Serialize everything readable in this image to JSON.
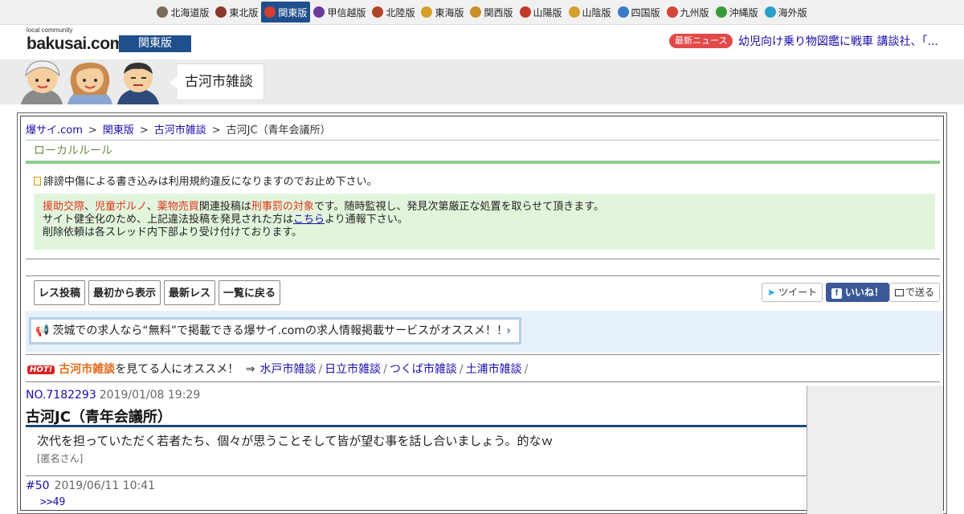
{
  "regions": [
    {
      "label": "北海道版",
      "color": "#7a6a5a",
      "active": false
    },
    {
      "label": "東北版",
      "color": "#8a3a2a",
      "active": false
    },
    {
      "label": "関東版",
      "color": "#d43d2f",
      "active": true
    },
    {
      "label": "甲信越版",
      "color": "#6a3a9a",
      "active": false
    },
    {
      "label": "北陸版",
      "color": "#b0442a",
      "active": false
    },
    {
      "label": "東海版",
      "color": "#d4a02a",
      "active": false
    },
    {
      "label": "関西版",
      "color": "#c8902a",
      "active": false
    },
    {
      "label": "山陽版",
      "color": "#c23a2a",
      "active": false
    },
    {
      "label": "山陰版",
      "color": "#d4a02a",
      "active": false
    },
    {
      "label": "四国版",
      "color": "#3a7ac8",
      "active": false
    },
    {
      "label": "九州版",
      "color": "#d4453a",
      "active": false
    },
    {
      "label": "沖縄版",
      "color": "#3a9a3a",
      "active": false
    },
    {
      "label": "海外版",
      "color": "#2aa0c8",
      "active": false
    }
  ],
  "header": {
    "logo_small": "local community",
    "logo": "bakusai.com",
    "edition": "関東版",
    "news_badge": "最新ニュース",
    "news_text": "幼児向け乗り物図鑑に戦車 講談社、「..."
  },
  "banner": {
    "title": "古河市雑談"
  },
  "breadcrumb": {
    "items": [
      "爆サイ.com",
      "関東版",
      "古河市雑談"
    ],
    "current": "古河JC（青年会議所）",
    "sep": ">"
  },
  "rules": {
    "heading": "ローカルルール",
    "notice": "誹謗中傷による書き込みは利用規約違反になりますのでお止め下さい。",
    "red1": "援助交際",
    "comma": "、",
    "red2": "児童ポルノ",
    "red3": "薬物売買",
    "mid": "関連投稿は",
    "red4": "刑事罰の対象",
    "tail": "です。随時監視し、発見次第厳正な処置を取らせて頂きます。",
    "line2a": "サイト健全化のため、上記違法投稿を発見された方は",
    "line2link": "こちら",
    "line2b": "より通報下さい。",
    "line3": "削除依頼は各スレッド内下部より受け付けております。"
  },
  "buttons": {
    "post": "レス投稿",
    "first": "最初から表示",
    "latest": "最新レス",
    "back": "一覧に戻る",
    "tweet": "ツイート",
    "like": "いいね！",
    "send": "で送る"
  },
  "promo": {
    "text": "茨城での求人なら“無料”で掲載できる爆サイ.comの求人情報掲載サービスがオススメ！！",
    "chevron": "›"
  },
  "hot": {
    "badge": "HOT!",
    "board": "古河市雑談",
    "text": "を見てる人にオススメ！",
    "arrow": "⇒",
    "links": [
      "水戸市雑談",
      "日立市雑談",
      "つくば市雑談",
      "土浦市雑談"
    ],
    "slash": "/"
  },
  "thread": {
    "no": "NO.7182293",
    "date": "2019/01/08 19:29",
    "title": "古河JC（青年会議所）",
    "body": "次代を担っていただく若者たち、個々が思うことそして皆が望む事を話し合いましょう。的なｗ",
    "author": "[匿名さん]"
  },
  "reply": {
    "no": "#50",
    "date": "2019/06/11 10:41",
    "body": ">>49"
  }
}
